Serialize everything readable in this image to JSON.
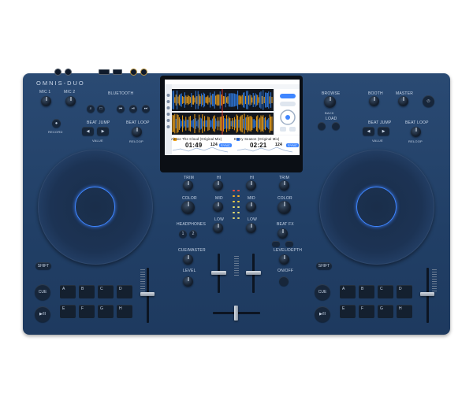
{
  "device": {
    "brand": "OMNIS-DUO",
    "colors": {
      "body": "#213f66",
      "accent_blue": "#3f86ff",
      "wave_blue": "#2f7be0",
      "wave_orange": "#f0a21a"
    }
  },
  "left_deck": {
    "mic1": "MIC 1",
    "mic2": "MIC 2",
    "bluetooth": "BLUETOOTH",
    "record_label": "RECORD",
    "beat_jump": "BEAT JUMP",
    "beat_loop": "BEAT LOOP",
    "value": "VALUE",
    "reloop": "RELOOP",
    "shift": "SHIFT",
    "cue": "CUE",
    "play": "▶/II",
    "pads": [
      "A",
      "B",
      "C",
      "D",
      "E",
      "F",
      "G",
      "H"
    ]
  },
  "right_deck": {
    "browse": "BROWSE",
    "back": "BACK",
    "load": "LOAD",
    "booth": "BOOTH",
    "master": "MASTER",
    "beat_jump": "BEAT JUMP",
    "beat_loop": "BEAT LOOP",
    "value": "VALUE",
    "reloop": "RELOOP",
    "shift": "SHIFT",
    "cue": "CUE",
    "play": "▶/II",
    "pads": [
      "A",
      "B",
      "C",
      "D",
      "E",
      "F",
      "G",
      "H"
    ]
  },
  "mixer": {
    "trim": "TRIM",
    "hi": "HI",
    "mid": "MID",
    "low": "LOW",
    "color": "COLOR",
    "headphones": "HEADPHONES",
    "beat_fx": "BEAT FX",
    "cue_master": "CUE/MASTER",
    "level": "LEVEL",
    "level_depth": "LEVEL/DEPTH",
    "on_off": "ON/OFF",
    "hp_buttons": [
      "1",
      "2"
    ]
  },
  "screen": {
    "deck1_track": "Above The Cloud (Original Mix)",
    "deck2_track": "Every Season (Original Mix)",
    "deck1_time": "01:49",
    "deck2_time": "02:21",
    "deck1_bpm": "124",
    "deck2_bpm": "124",
    "sync": "SYNC"
  }
}
